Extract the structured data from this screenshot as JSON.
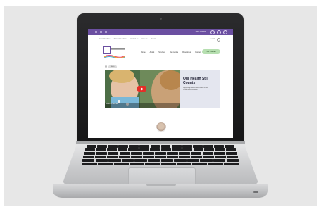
{
  "site": {
    "topbar": {
      "phone": "0800 000 000",
      "color": "#6b4fa1"
    },
    "utility_links": [
      "Covid19 advice",
      "Referral Guidance",
      "Contact us",
      "Careers",
      "Donate"
    ],
    "search_label": "Search",
    "nav": [
      "Home",
      "About",
      "Services",
      "Our people",
      "Resources",
      "Contact"
    ],
    "cta_label": "Get involved",
    "feature": {
      "badge": "Watch",
      "title": "Our Health Still Counts",
      "text": "Supporting families and children in the communities we serve.",
      "video_caption": "Watch on YouTube"
    }
  }
}
